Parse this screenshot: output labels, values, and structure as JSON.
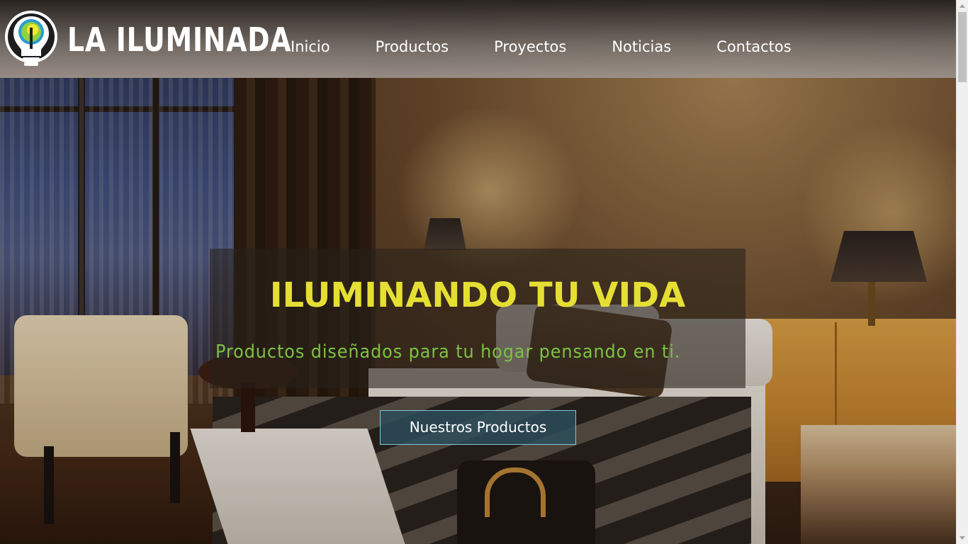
{
  "brand": {
    "name": "LA ILUMINADA",
    "logo_icon": "lightbulb-logo-icon",
    "colors": {
      "bulb_outer": "#8fd13f",
      "bulb_inner": "#f2ea31",
      "ring": "#2a9bd6"
    }
  },
  "nav": {
    "items": [
      {
        "label": "Inicio"
      },
      {
        "label": "Productos"
      },
      {
        "label": "Proyectos"
      },
      {
        "label": "Noticias"
      },
      {
        "label": "Contactos"
      }
    ]
  },
  "hero": {
    "title": "ILUMINANDO TU VIDA",
    "subtitle": "Productos diseñados para tu hogar pensando en ti.",
    "button_label": "Nuestros Productos",
    "colors": {
      "title": "#e6df33",
      "subtitle": "#7cc242",
      "button_border": "#7fc6d6"
    }
  }
}
